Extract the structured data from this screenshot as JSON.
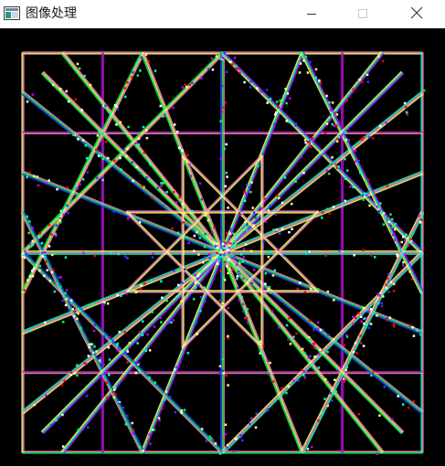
{
  "window": {
    "title": "图像处理",
    "icon": "app-window-icon",
    "controls": {
      "minimize_icon": "minimize-icon",
      "maximize_icon": "maximize-icon",
      "close_icon": "close-icon"
    }
  },
  "canvas": {
    "background": "#000000",
    "content": "line-pattern",
    "colors": {
      "pink": "#ff8cc6",
      "yellow": "#ffff6e",
      "green": "#00ff55",
      "cyan": "#00ffd0",
      "magenta": "#c000ff",
      "red": "#ff0000",
      "blue": "#2040ff",
      "white": "#ffffff",
      "purple": "#a020a0"
    }
  }
}
